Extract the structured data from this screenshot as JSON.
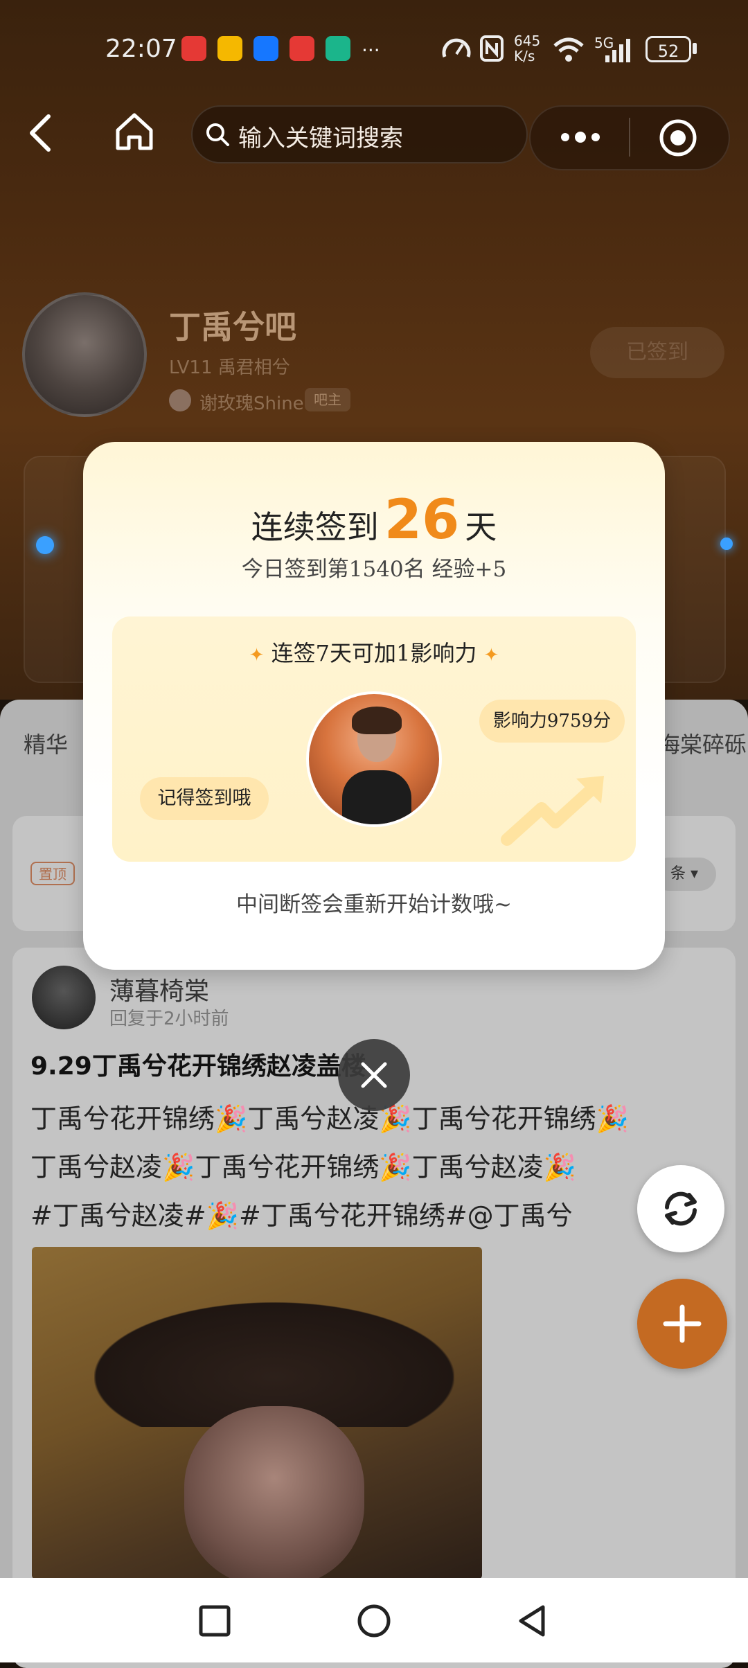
{
  "status_bar": {
    "time": "22:07",
    "network_speed": "645\nK/s",
    "network_type": "5G",
    "battery": "52",
    "more_dots": "···"
  },
  "top_nav": {
    "search_placeholder": "输入关键词搜索"
  },
  "forum": {
    "name": "丁禹兮吧",
    "level": "LV11  禹君相兮",
    "owner_name": "谢玫瑰Shine",
    "owner_tag": "吧主",
    "signed_label": "已签到"
  },
  "tabs": {
    "left": "精华",
    "right": "海棠碎砾"
  },
  "sticky": {
    "tag": "置顶",
    "sort_label": "条 ▾"
  },
  "post": {
    "author": "薄暮椅棠",
    "time": "回复于2小时前",
    "title": "9.29丁禹兮花开锦绣赵凌盖楼",
    "line1": "丁禹兮花开锦绣🎉丁禹兮赵凌🎉丁禹兮花开锦绣🎉",
    "line2": "丁禹兮赵凌🎉丁禹兮花开锦绣🎉丁禹兮赵凌🎉",
    "line3": "#丁禹兮赵凌#🎉#丁禹兮花开锦绣#@丁禹兮"
  },
  "modal": {
    "streak_prefix": "连续签到",
    "streak_days": "26",
    "streak_suffix": "天",
    "today_info": "今日签到第1540名  经验+5",
    "bonus_title": "连签7天可加1影响力",
    "reminder_bubble": "记得签到哦",
    "influence_bubble": "影响力9759分",
    "footer_note": "中间断签会重新开始计数哦~"
  },
  "colors": {
    "accent_orange": "#f08a1a",
    "add_button": "#c46a22"
  }
}
